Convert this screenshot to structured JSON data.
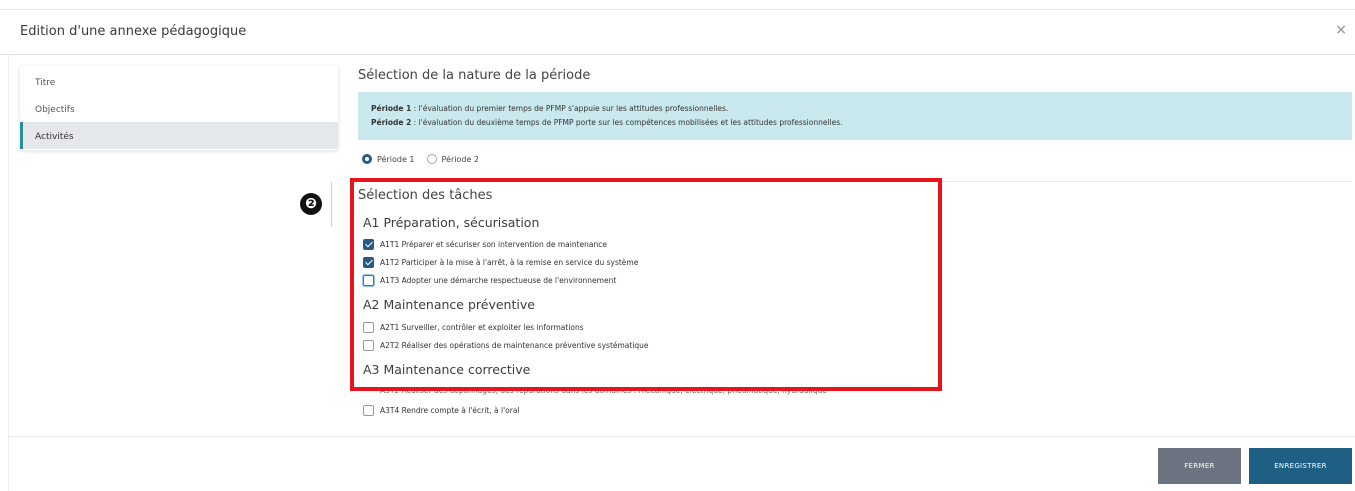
{
  "modal": {
    "title": "Edition d'une annexe pédagogique",
    "close_glyph": "×"
  },
  "sidebar": {
    "items": [
      {
        "label": "Titre",
        "active": false
      },
      {
        "label": "Objectifs",
        "active": false
      },
      {
        "label": "Activités",
        "active": true
      }
    ]
  },
  "period": {
    "title": "Sélection de la nature de la période",
    "info": [
      {
        "label": "Période 1",
        "text": " : l'évaluation du premier temps de PFMP s'appuie sur les attitudes professionnelles."
      },
      {
        "label": "Période 2",
        "text": " : l'évaluation du deuxième temps de PFMP porte sur les compétences mobilisées et les attitudes professionnelles."
      }
    ],
    "options": [
      {
        "label": "Période 1",
        "selected": true
      },
      {
        "label": "Période 2",
        "selected": false
      }
    ]
  },
  "annotation": {
    "badge": "❷"
  },
  "tasks": {
    "title": "Sélection des tâches",
    "groups": [
      {
        "title": "A1 Préparation, sécurisation",
        "items": [
          {
            "label": "A1T1 Préparer et sécuriser son intervention de maintenance",
            "checked": true
          },
          {
            "label": "A1T2 Participer à la mise à l'arrêt, à la remise en service du système",
            "checked": true
          },
          {
            "label": "A1T3 Adopter une démarche respectueuse de l'environnement",
            "checked": false
          }
        ]
      },
      {
        "title": "A2 Maintenance préventive",
        "items": [
          {
            "label": "A2T1 Surveiller, contrôler et exploiter les informations",
            "checked": false
          },
          {
            "label": "A2T2 Réaliser des opérations de maintenance préventive systématique",
            "checked": false
          }
        ]
      },
      {
        "title": "A3 Maintenance corrective",
        "items": [
          {
            "label": "A3T4 Rendre compte à l'écrit, à l'oral",
            "checked": false
          }
        ]
      }
    ],
    "partially_hidden_text": "A3T2 Réaliser des dépannages, des réparations dans les domaines : mécanique, électrique, pneumatique, hydraulique"
  },
  "footer": {
    "close_label": "FERMER",
    "save_label": "ENREGISTRER"
  },
  "colors": {
    "accent": "#245c86",
    "info_bg": "#c9e9ef",
    "highlight": "#e8131b",
    "button_secondary": "#6b7480",
    "button_primary": "#1f5f83"
  }
}
